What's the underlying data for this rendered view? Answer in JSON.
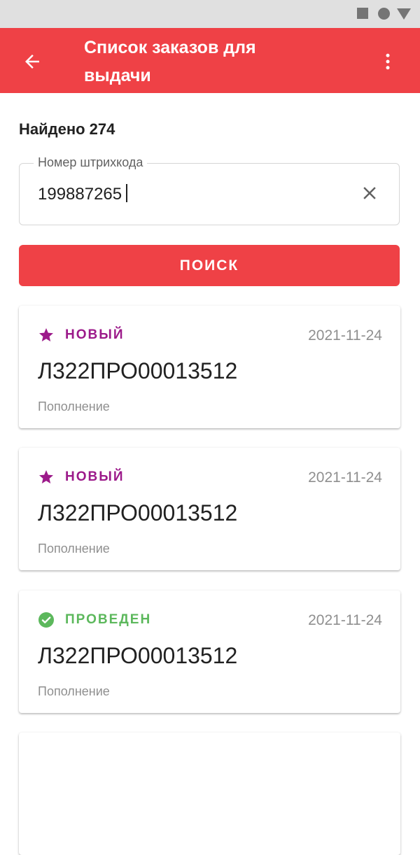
{
  "app_bar": {
    "title": "Список заказов для выдачи",
    "color": "#ef4146",
    "back_icon": "arrow-back-icon",
    "menu_icon": "more-vert-icon"
  },
  "status_bar": {
    "icons": [
      "square-icon",
      "circle-icon",
      "triangle-icon"
    ]
  },
  "found_text": "Найдено 274",
  "search": {
    "label": "Номер штрихкода",
    "value": "199887265",
    "clear_icon": "close-icon",
    "button_label": "ПОИСК"
  },
  "orders": [
    {
      "status": "НОВЫЙ",
      "status_icon": "star-icon",
      "status_color": "#9c1a8a",
      "date": "2021-11-24",
      "number": "Л322ПРО00013512",
      "type": "Пополнение"
    },
    {
      "status": "НОВЫЙ",
      "status_icon": "star-icon",
      "status_color": "#9c1a8a",
      "date": "2021-11-24",
      "number": "Л322ПРО00013512",
      "type": "Пополнение"
    },
    {
      "status": "ПРОВЕДЕН",
      "status_icon": "check-circle-icon",
      "status_color": "#5cb85c",
      "date": "2021-11-24",
      "number": "Л322ПРО00013512",
      "type": "Пополнение"
    }
  ]
}
